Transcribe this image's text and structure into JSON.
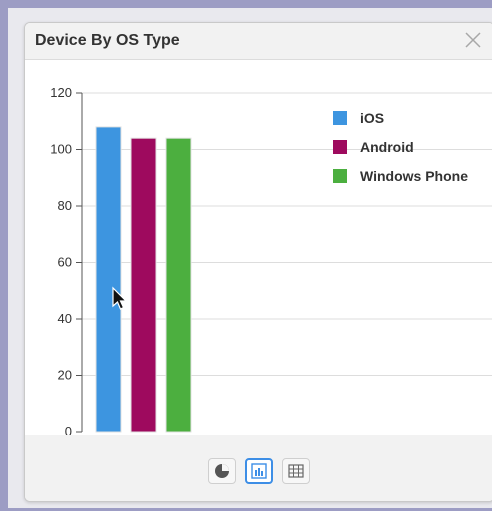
{
  "panel": {
    "title": "Device By OS Type"
  },
  "icons": {
    "close": "close-icon",
    "pie_view": "pie-chart-icon",
    "bar_view": "bar-chart-icon",
    "table_view": "table-grid-icon",
    "cursor": "mouse-pointer-icon"
  },
  "colors": {
    "ios": "#3d95e0",
    "android": "#9e0a5e",
    "windows_phone": "#4caf3f",
    "active_view": "#3d8ee6"
  },
  "chart_data": {
    "type": "bar",
    "categories": [
      "iOS",
      "Android",
      "Windows Phone"
    ],
    "values": [
      108,
      104,
      104
    ],
    "colors": [
      "#3d95e0",
      "#9e0a5e",
      "#4caf3f"
    ],
    "title": "Device By OS Type",
    "xlabel": "",
    "ylabel": "",
    "ylim": [
      0,
      120
    ],
    "yticks": [
      "0",
      "20",
      "40",
      "60",
      "80",
      "100",
      "120"
    ],
    "grid": true,
    "legend": "top-right",
    "legend_entries": [
      "iOS",
      "Android",
      "Windows Phone"
    ]
  }
}
